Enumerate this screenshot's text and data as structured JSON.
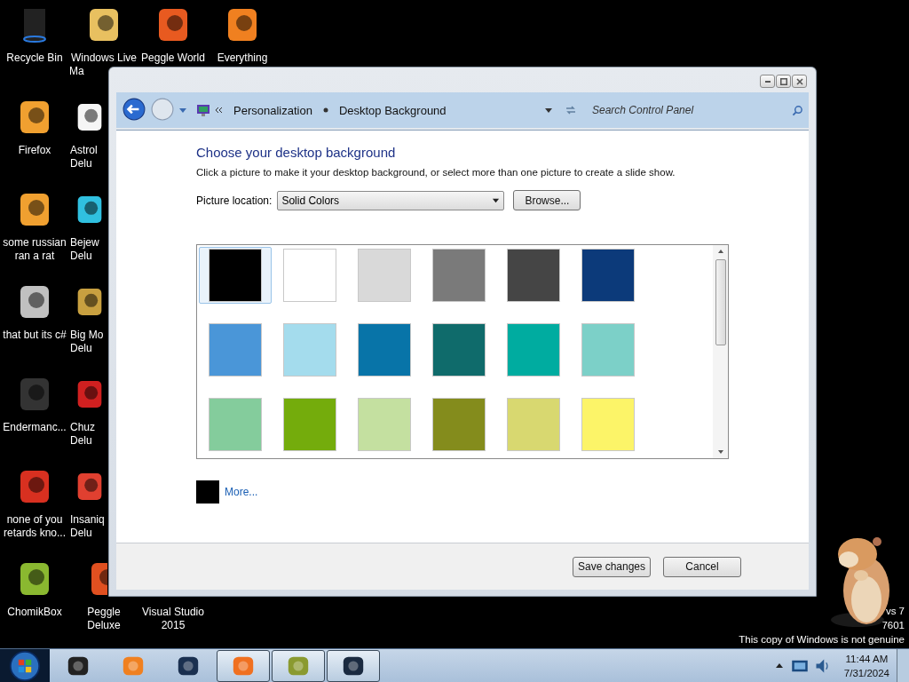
{
  "desktop": {
    "icons": [
      {
        "label": "Recycle Bin"
      },
      {
        "label": "Windows Live Ma"
      },
      {
        "label": "Peggle World"
      },
      {
        "label": "Everything"
      },
      {
        "label": "Firefox"
      },
      {
        "label": "Astrol Delu"
      },
      {
        "label": "some russian ran a rat"
      },
      {
        "label": "Bejew Delu"
      },
      {
        "label": "that but its c#"
      },
      {
        "label": "Big Mo Delu"
      },
      {
        "label": "Endermanc..."
      },
      {
        "label": "Chuz Delu"
      },
      {
        "label": "none of you retards kno..."
      },
      {
        "label": "Insaniq Delu"
      },
      {
        "label": "ChomikBox"
      },
      {
        "label": "Peggle Deluxe"
      },
      {
        "label": "Visual Studio 2015"
      }
    ],
    "watermark": [
      "vs 7",
      "7601",
      "This copy of Windows is not genuine"
    ]
  },
  "window": {
    "breadcrumb": [
      "Personalization",
      "Desktop Background"
    ],
    "search": {
      "placeholder": "Search Control Panel"
    },
    "heading": "Choose your desktop background",
    "description": "Click a picture to make it your desktop background, or select more than one picture to create a slide show.",
    "location": {
      "label": "Picture location:",
      "value": "Solid Colors",
      "browse": "Browse..."
    },
    "swatches": [
      {
        "color": "#000000",
        "selected": true
      },
      {
        "color": "#ffffff",
        "selected": false
      },
      {
        "color": "#d9d9d9",
        "selected": false
      },
      {
        "color": "#7a7a7a",
        "selected": false
      },
      {
        "color": "#454545",
        "selected": false
      },
      {
        "color": "#0c3a7a",
        "selected": false
      },
      {
        "color": "#4a96d8",
        "selected": false
      },
      {
        "color": "#a4dced",
        "selected": false
      },
      {
        "color": "#0874a8",
        "selected": false
      },
      {
        "color": "#0f6b6b",
        "selected": false
      },
      {
        "color": "#00aca0",
        "selected": false
      },
      {
        "color": "#7cd0c8",
        "selected": false
      },
      {
        "color": "#84cc9c",
        "selected": false
      },
      {
        "color": "#74ac0c",
        "selected": false
      },
      {
        "color": "#c4e0a0",
        "selected": false
      },
      {
        "color": "#848c1c",
        "selected": false
      },
      {
        "color": "#d8d870",
        "selected": false
      },
      {
        "color": "#fcf468",
        "selected": false
      }
    ],
    "more": {
      "color": "#000000",
      "label": "More..."
    },
    "buttons": [
      "Save changes",
      "Cancel"
    ]
  },
  "taskbar": {
    "tasks": [
      {
        "active": false
      },
      {
        "active": false
      },
      {
        "active": false
      },
      {
        "active": true
      },
      {
        "active": true
      },
      {
        "active": true
      }
    ],
    "clock": {
      "time": "11:44 AM",
      "date": "7/31/2024"
    }
  }
}
